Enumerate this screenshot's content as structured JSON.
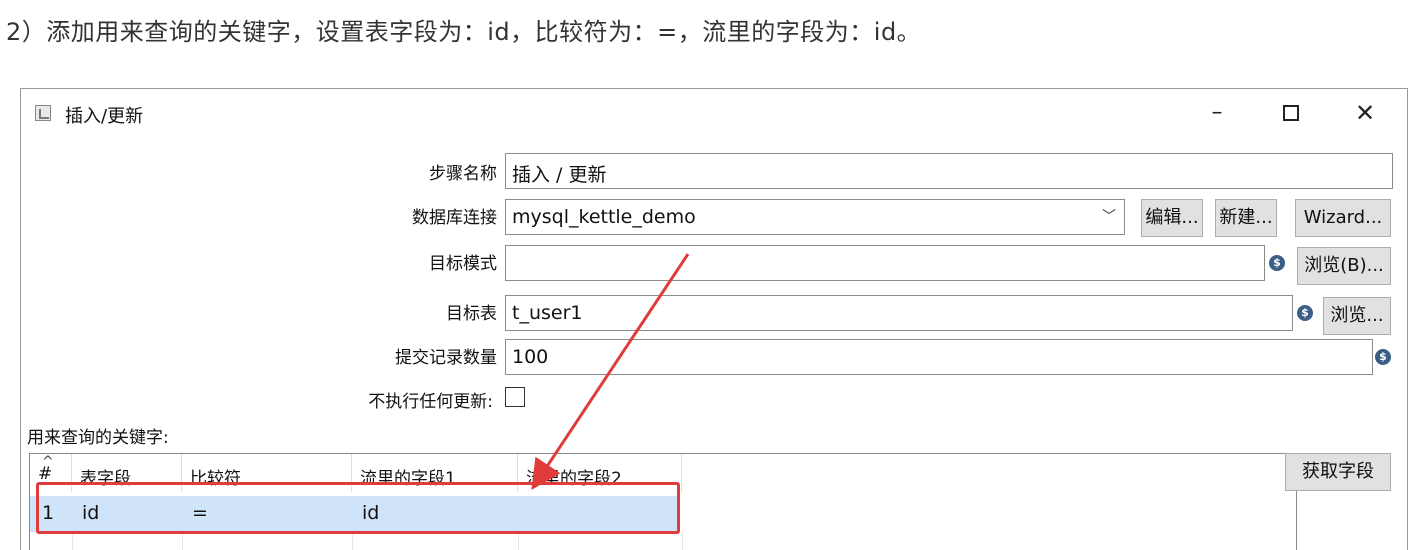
{
  "instruction": "2）添加用来查询的关键字，设置表字段为：id，比较符为：=，流里的字段为：id。",
  "window": {
    "title": "插入/更新",
    "controls": {
      "minimize": "–",
      "close": "✕"
    }
  },
  "form": {
    "step_name": {
      "label": "步骤名称",
      "value": "插入 / 更新"
    },
    "db_connection": {
      "label": "数据库连接",
      "value": "mysql_kettle_demo",
      "edit_button": "编辑...",
      "new_button": "新建...",
      "wizard_button": "Wizard..."
    },
    "target_schema": {
      "label": "目标模式",
      "value": "",
      "browse_button": "浏览(B)..."
    },
    "target_table": {
      "label": "目标表",
      "value": "t_user1",
      "browse_button": "浏览..."
    },
    "commit_size": {
      "label": "提交记录数量",
      "value": "100"
    },
    "no_update": {
      "label": "不执行任何更新:",
      "checked": false
    }
  },
  "keys_section": {
    "label": "用来查询的关键字:",
    "columns": [
      "#",
      "表字段",
      "比较符",
      "流里的字段1",
      "流里的字段2"
    ],
    "rows": [
      {
        "num": "1",
        "table_field": "id",
        "comparator": "=",
        "stream_field1": "id",
        "stream_field2": ""
      }
    ],
    "get_fields_button": "获取字段"
  },
  "icons": {
    "variable": "dollar-diamond-icon",
    "app": "step-icon"
  },
  "colors": {
    "annotation": "#e03c3c",
    "selection": "#cfe3f9"
  }
}
